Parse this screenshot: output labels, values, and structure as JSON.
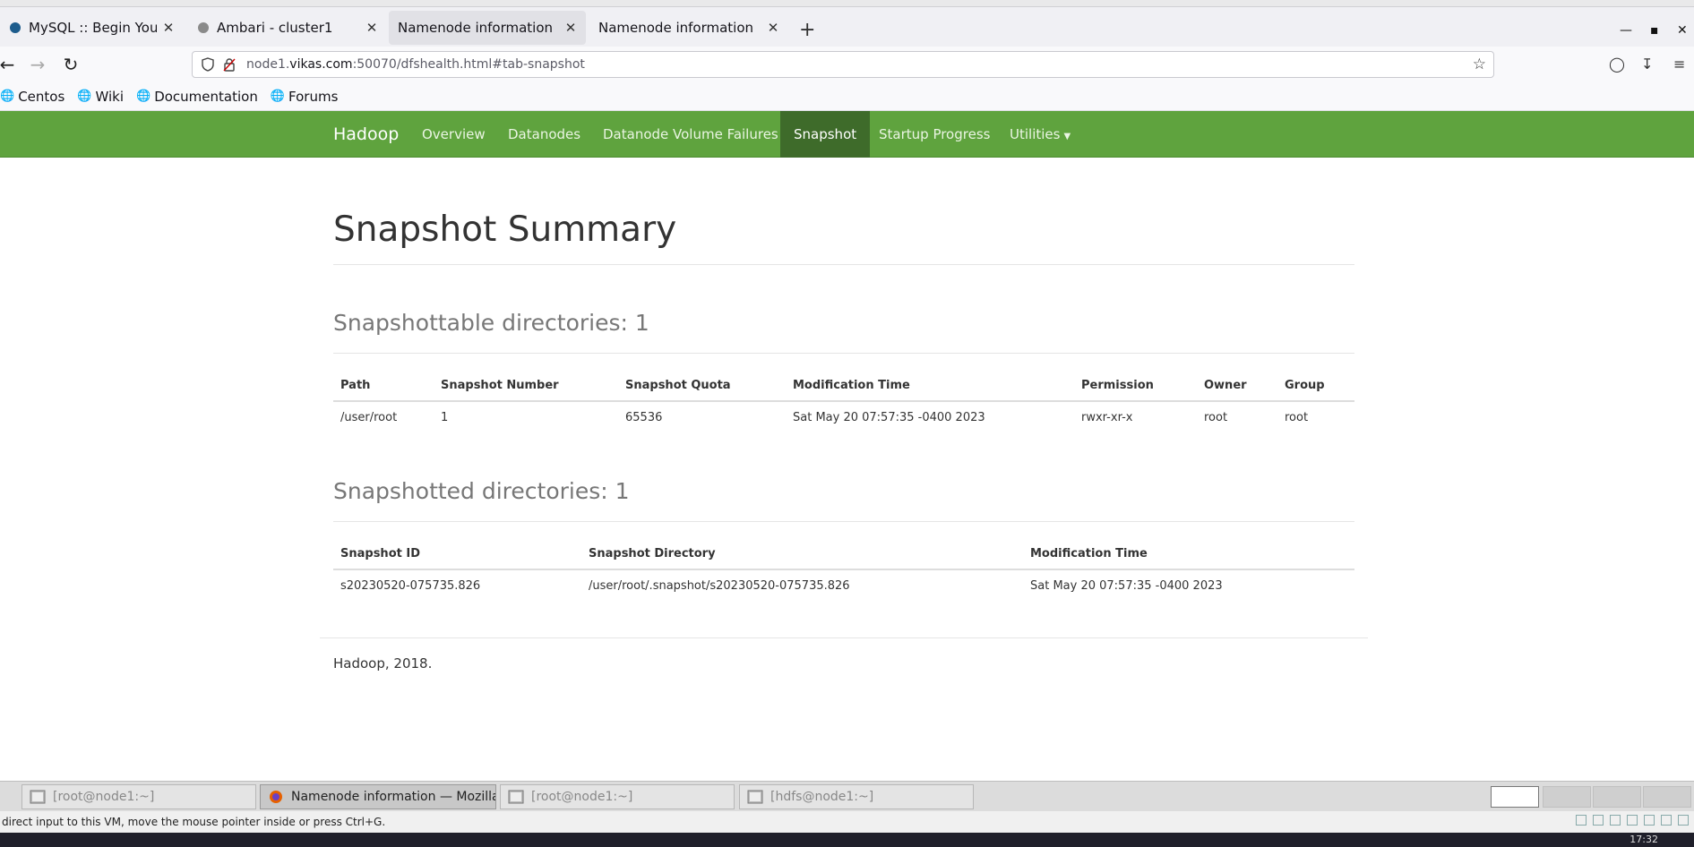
{
  "browser": {
    "tabs": [
      {
        "title": "MySQL :: Begin Your Dow",
        "active": false
      },
      {
        "title": "Ambari - cluster1",
        "active": false
      },
      {
        "title": "Namenode information",
        "active": true
      },
      {
        "title": "Namenode information",
        "active": false
      }
    ],
    "url_prefix": "node1.",
    "url_domain": "vikas.com",
    "url_suffix": ":50070/dfshealth.html#tab-snapshot",
    "bookmarks": [
      "Centos",
      "Wiki",
      "Documentation",
      "Forums"
    ]
  },
  "hadoop": {
    "brand": "Hadoop",
    "nav": [
      "Overview",
      "Datanodes",
      "Datanode Volume Failures",
      "Snapshot",
      "Startup Progress",
      "Utilities"
    ],
    "active_nav": "Snapshot",
    "page_title": "Snapshot Summary",
    "snapshottable": {
      "heading": "Snapshottable directories: 1",
      "columns": [
        "Path",
        "Snapshot Number",
        "Snapshot Quota",
        "Modification Time",
        "Permission",
        "Owner",
        "Group"
      ],
      "rows": [
        [
          "/user/root",
          "1",
          "65536",
          "Sat May 20 07:57:35 -0400 2023",
          "rwxr-xr-x",
          "root",
          "root"
        ]
      ]
    },
    "snapshotted": {
      "heading": "Snapshotted directories: 1",
      "columns": [
        "Snapshot ID",
        "Snapshot Directory",
        "Modification Time"
      ],
      "rows": [
        [
          "s20230520-075735.826",
          "/user/root/.snapshot/s20230520-075735.826",
          "Sat May 20 07:57:35 -0400 2023"
        ]
      ]
    },
    "footer": "Hadoop, 2018."
  },
  "taskbar": {
    "tasks": [
      {
        "label": "[root@node1:~]",
        "active": false
      },
      {
        "label": "Namenode information — Mozilla Fi...",
        "active": true
      },
      {
        "label": "[root@node1:~]",
        "active": false
      },
      {
        "label": "[hdfs@node1:~]",
        "active": false
      }
    ],
    "status_text": "direct input to this VM, move the mouse pointer inside or press Ctrl+G.",
    "clock": "17:32"
  },
  "colors": {
    "hadoop_green": "#5fa33e",
    "hadoop_green_active": "#3e6b2a"
  }
}
